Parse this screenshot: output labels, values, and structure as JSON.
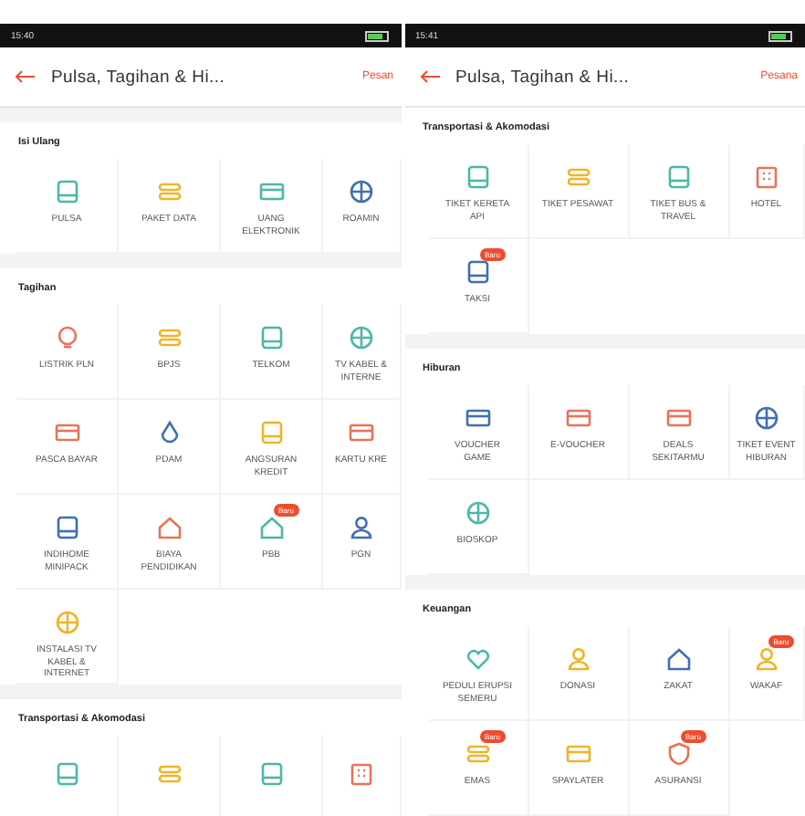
{
  "panels": [
    {
      "status_time": "15:40",
      "header": {
        "title": "Pulsa, Tagihan & Hi...",
        "action": "Pesan"
      },
      "sections": [
        {
          "title": "Isi Ulang",
          "items": [
            {
              "label": "PULSA"
            },
            {
              "label": "PAKET DATA"
            },
            {
              "label": "UANG ELEKTRONIK"
            },
            {
              "label": "ROAMIN"
            }
          ]
        },
        {
          "title": "Tagihan",
          "items": [
            {
              "label": "LISTRIK PLN"
            },
            {
              "label": "BPJS"
            },
            {
              "label": "TELKOM"
            },
            {
              "label": "TV KABEL & INTERNE"
            },
            {
              "label": "PASCA BAYAR"
            },
            {
              "label": "PDAM"
            },
            {
              "label": "ANGSURAN KREDIT"
            },
            {
              "label": "KARTU KRE"
            },
            {
              "label": "INDIHOME MINIPACK"
            },
            {
              "label": "BIAYA PENDIDIKAN"
            },
            {
              "label": "PBB",
              "badge": "Baru"
            },
            {
              "label": "PGN"
            },
            {
              "label": "INSTALASI TV KABEL & INTERNET"
            }
          ]
        },
        {
          "title": "Transportasi & Akomodasi",
          "items": [
            {
              "kind": "icon_only"
            },
            {
              "kind": "icon_only"
            },
            {
              "kind": "icon_only"
            },
            {
              "kind": "icon_only"
            }
          ]
        }
      ]
    },
    {
      "status_time": "15:41",
      "header": {
        "title": "Pulsa, Tagihan & Hi...",
        "action": "Pesana"
      },
      "sections": [
        {
          "title": "Transportasi & Akomodasi",
          "items": [
            {
              "label": "TIKET KERETA API"
            },
            {
              "label": "TIKET PESAWAT"
            },
            {
              "label": "TIKET BUS & TRAVEL"
            },
            {
              "label": "HOTEL"
            },
            {
              "label": "TAKSI",
              "badge": "Baru"
            }
          ]
        },
        {
          "title": "Hiburan",
          "items": [
            {
              "label": "VOUCHER GAME"
            },
            {
              "label": "E-VOUCHER"
            },
            {
              "label": "DEALS SEKITARMU"
            },
            {
              "label": "TIKET EVENT HIBURAN"
            },
            {
              "label": "BIOSKOP"
            }
          ]
        },
        {
          "title": "Keuangan",
          "items": [
            {
              "label": "PEDULI ERUPSI SEMERU"
            },
            {
              "label": "DONASI"
            },
            {
              "label": "ZAKAT"
            },
            {
              "label": "WAKAF",
              "badge": "Baru"
            },
            {
              "label": "EMAS",
              "badge": "Baru"
            },
            {
              "label": "SPAYLATER"
            },
            {
              "label": "ASURANSI",
              "badge": "Baru"
            }
          ]
        }
      ]
    }
  ]
}
